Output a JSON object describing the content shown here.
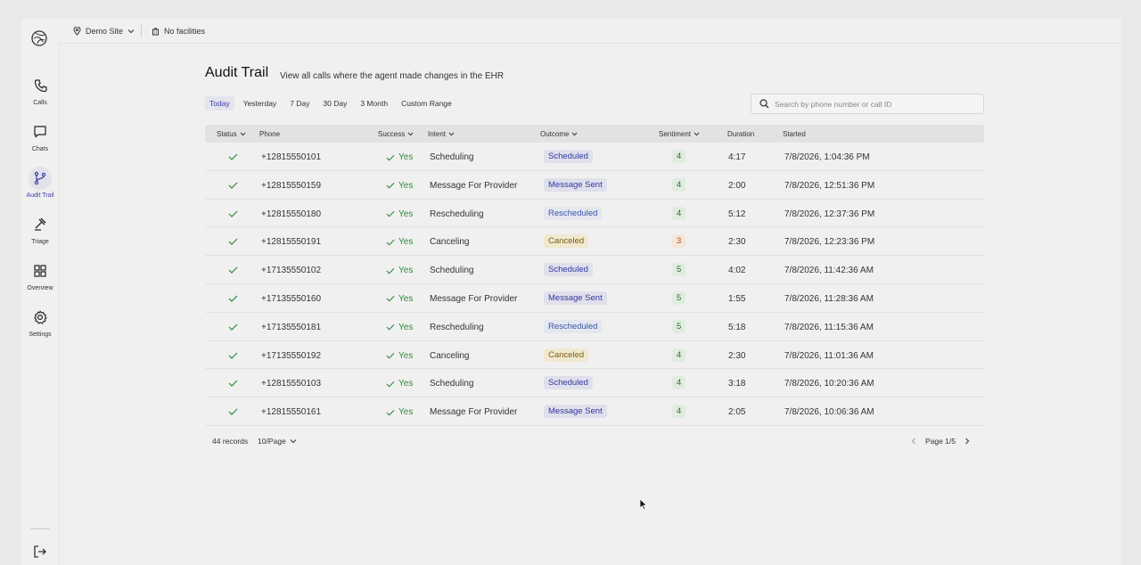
{
  "topbar": {
    "site": "Demo Site",
    "facilities": "No facilities"
  },
  "nav": [
    {
      "label": "Calls",
      "icon": "phone-icon",
      "active": false
    },
    {
      "label": "Chats",
      "icon": "chat-icon",
      "active": false
    },
    {
      "label": "Audit Trail",
      "icon": "audit-branch-icon",
      "active": true
    },
    {
      "label": "Triage",
      "icon": "gavel-icon",
      "active": false
    },
    {
      "label": "Overview",
      "icon": "grid-icon",
      "active": false
    },
    {
      "label": "Settings",
      "icon": "gear-icon",
      "active": false
    }
  ],
  "page": {
    "title": "Audit Trail",
    "subtitle": "View all calls where the agent made changes in the EHR"
  },
  "filters": [
    "Today",
    "Yesterday",
    "7 Day",
    "30 Day",
    "3 Month",
    "Custom Range"
  ],
  "active_filter": 0,
  "search": {
    "placeholder": "Search by phone number or call ID"
  },
  "columns": [
    "Status",
    "Phone",
    "Success",
    "Intent",
    "Outcome",
    "Sentiment",
    "Duration",
    "Started"
  ],
  "rows": [
    {
      "phone": "+12815550101",
      "success": "Yes",
      "intent": "Scheduling",
      "outcome": "Scheduled",
      "sentiment": "4",
      "duration": "4:17",
      "started": "7/8/2026, 1:04:36 PM"
    },
    {
      "phone": "+12815550159",
      "success": "Yes",
      "intent": "Message For Provider",
      "outcome": "Message Sent",
      "sentiment": "4",
      "duration": "2:00",
      "started": "7/8/2026, 12:51:36 PM"
    },
    {
      "phone": "+12815550180",
      "success": "Yes",
      "intent": "Rescheduling",
      "outcome": "Rescheduled",
      "sentiment": "4",
      "duration": "5:12",
      "started": "7/8/2026, 12:37:36 PM"
    },
    {
      "phone": "+12815550191",
      "success": "Yes",
      "intent": "Canceling",
      "outcome": "Canceled",
      "sentiment": "3",
      "duration": "2:30",
      "started": "7/8/2026, 12:23:36 PM"
    },
    {
      "phone": "+17135550102",
      "success": "Yes",
      "intent": "Scheduling",
      "outcome": "Scheduled",
      "sentiment": "5",
      "duration": "4:02",
      "started": "7/8/2026, 11:42:36 AM"
    },
    {
      "phone": "+17135550160",
      "success": "Yes",
      "intent": "Message For Provider",
      "outcome": "Message Sent",
      "sentiment": "5",
      "duration": "1:55",
      "started": "7/8/2026, 11:28:36 AM"
    },
    {
      "phone": "+17135550181",
      "success": "Yes",
      "intent": "Rescheduling",
      "outcome": "Rescheduled",
      "sentiment": "5",
      "duration": "5:18",
      "started": "7/8/2026, 11:15:36 AM"
    },
    {
      "phone": "+17135550192",
      "success": "Yes",
      "intent": "Canceling",
      "outcome": "Canceled",
      "sentiment": "4",
      "duration": "2:30",
      "started": "7/8/2026, 11:01:36 AM"
    },
    {
      "phone": "+12815550103",
      "success": "Yes",
      "intent": "Scheduling",
      "outcome": "Scheduled",
      "sentiment": "4",
      "duration": "3:18",
      "started": "7/8/2026, 10:20:36 AM"
    },
    {
      "phone": "+12815550161",
      "success": "Yes",
      "intent": "Message For Provider",
      "outcome": "Message Sent",
      "sentiment": "4",
      "duration": "2:05",
      "started": "7/8/2026, 10:06:36 AM"
    }
  ],
  "footer": {
    "records": "44 records",
    "per_page": "10/Page",
    "page": "Page 1/5"
  },
  "colors": {
    "accent": "#3b3fa8",
    "success": "#2f8a3b",
    "canceled_bg": "#f1e9cf"
  }
}
